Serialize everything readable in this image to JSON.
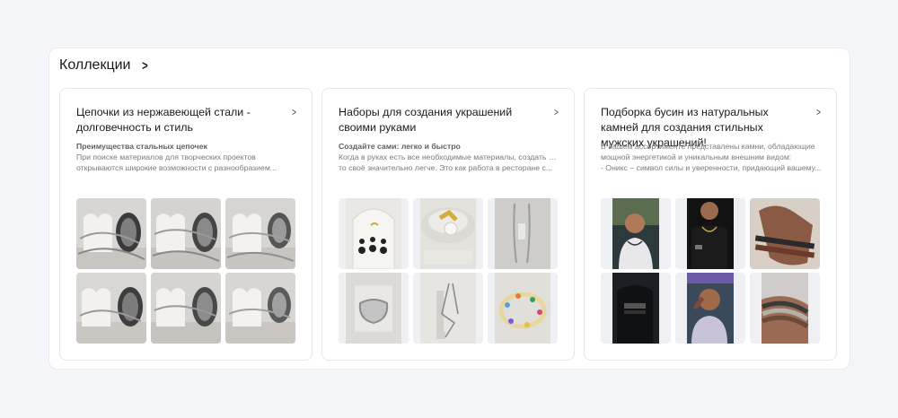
{
  "section": {
    "title": "Коллекции"
  },
  "cards": [
    {
      "title": "Цепочки из нержавеющей стали - долговечность и стиль",
      "subtitle": "Преимущества стальных цепочек",
      "desc_lines": [
        "При поиске материалов для творческих проектов",
        "открываются широкие возможности с разнообразием..."
      ],
      "thumb_theme": "chains"
    },
    {
      "title": "Наборы для создания украшений своими руками",
      "subtitle": "Создайте сами: легко и быстро",
      "desc_lines": [
        "Когда в руках есть все необходимые материалы, создать что-",
        "то своё значительно легче. Это как работа в ресторане с..."
      ],
      "thumb_theme": "kits"
    },
    {
      "title": "Подборка бусин из натуральных камней для создания стильных мужских украшений!",
      "subtitle": "",
      "desc_lines": [
        "В нашем ассортименте представлены камни, обладающие",
        "мощной энергетикой и уникальным внешним видом:",
        "- Оникс – символ силы и уверенности, придающий вашему..."
      ],
      "thumb_theme": "men"
    }
  ],
  "icons": {
    "header_chevron": "chevron-right-icon",
    "card_chevron": "chevron-right-icon"
  }
}
